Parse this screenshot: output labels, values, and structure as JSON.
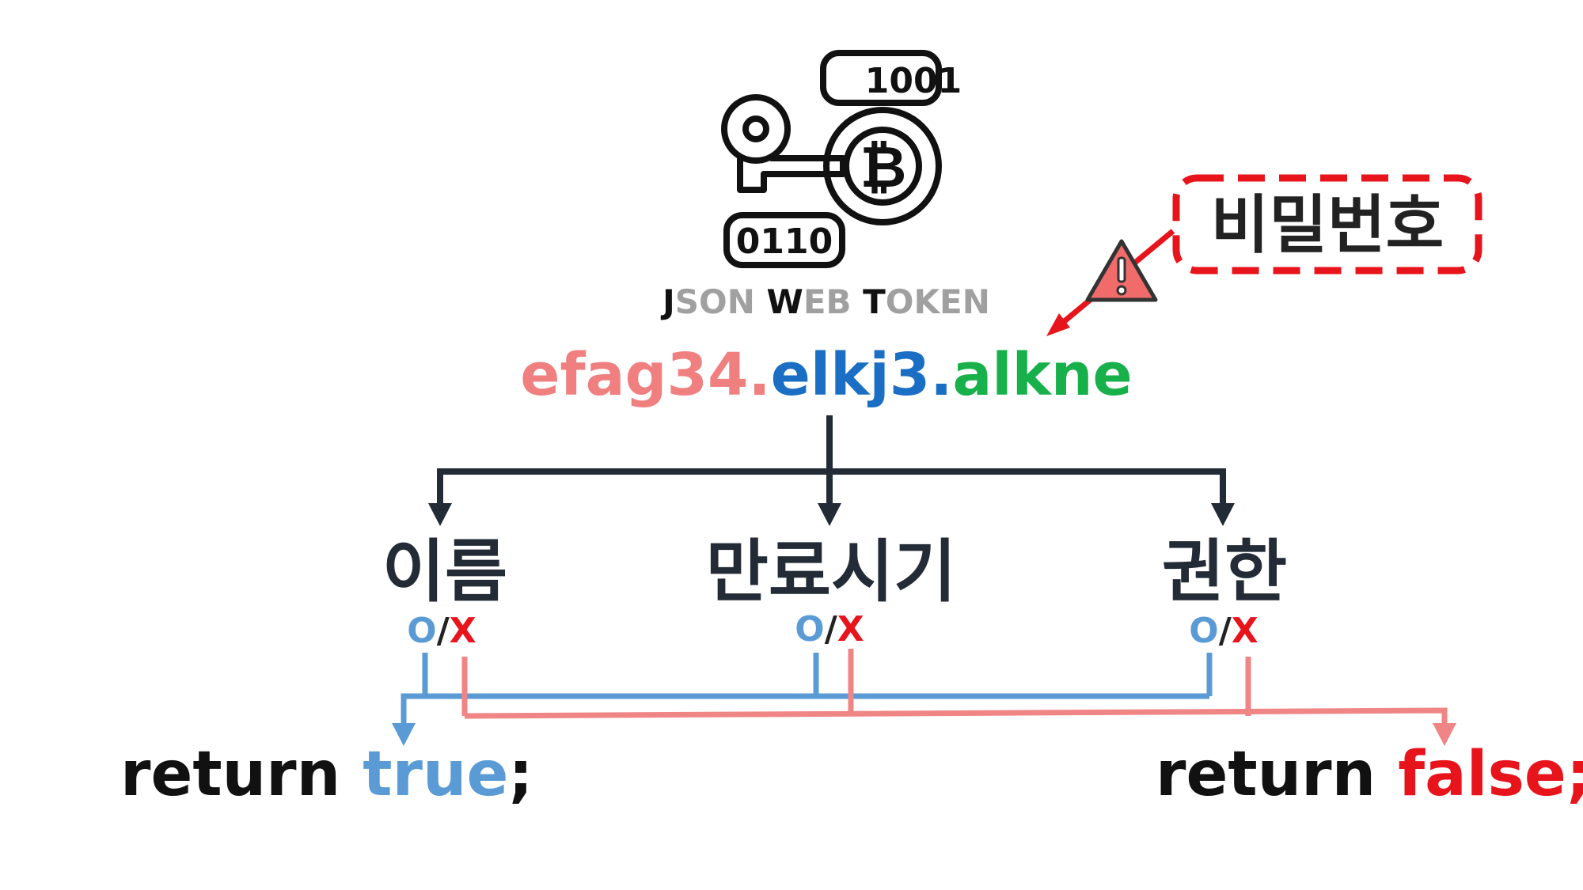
{
  "logo": {
    "icon": "jwt-key-coin-binary-icon",
    "binary_top": "1001",
    "binary_bottom": "0110",
    "coin_symbol": "₿",
    "caption_parts": [
      "J",
      "SON ",
      "W",
      "EB ",
      "T",
      "OKEN"
    ]
  },
  "secret": {
    "label": "비밀번호",
    "warning_icon": "warning-triangle-icon",
    "border_color": "#e8141c"
  },
  "token": {
    "header": "efag34.",
    "payload": "elkj3.",
    "signature": "alkne",
    "colors": {
      "header": "#f08080",
      "payload": "#1a6fc4",
      "signature": "#17b04a"
    }
  },
  "claims": [
    {
      "label": "이름",
      "ok": "O",
      "sep": "/",
      "fail": "X"
    },
    {
      "label": "만료시기",
      "ok": "O",
      "sep": "/",
      "fail": "X"
    },
    {
      "label": "권한",
      "ok": "O",
      "sep": "/",
      "fail": "X"
    }
  ],
  "results": {
    "true": {
      "keyword": "return",
      "value": "true",
      "semicolon": ";"
    },
    "false": {
      "keyword": "return",
      "value": "false;"
    }
  },
  "colors": {
    "tree": "#232b36",
    "ok": "#5b9bd5",
    "fail": "#f08585",
    "fail_text": "#e8141c",
    "ok_text": "#5b9bd5"
  }
}
